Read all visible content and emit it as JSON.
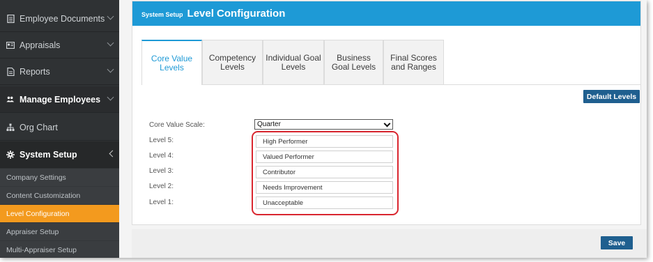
{
  "sidebar": {
    "items": [
      {
        "label": "Employee Documents",
        "icon": "document-icon"
      },
      {
        "label": "Appraisals",
        "icon": "id-card-icon"
      },
      {
        "label": "Reports",
        "icon": "report-icon"
      },
      {
        "label": "Manage Employees",
        "icon": "users-icon"
      },
      {
        "label": "Org Chart",
        "icon": "org-chart-icon"
      },
      {
        "label": "System Setup",
        "icon": "gear-icon"
      }
    ],
    "sub_items": [
      {
        "label": "Company Settings"
      },
      {
        "label": "Content Customization"
      },
      {
        "label": "Level Configuration"
      },
      {
        "label": "Appraiser Setup"
      },
      {
        "label": "Multi-Appraiser Setup"
      }
    ],
    "active_sub_item": "Level Configuration"
  },
  "header": {
    "section": "System Setup",
    "title": "Level Configuration"
  },
  "tabs": [
    {
      "label": "Core Value Levels",
      "active": true
    },
    {
      "label": "Competency Levels",
      "active": false
    },
    {
      "label": "Individual Goal Levels",
      "active": false
    },
    {
      "label": "Business Goal Levels",
      "active": false
    },
    {
      "label": "Final Scores and Ranges",
      "active": false
    }
  ],
  "buttons": {
    "default_levels": "Default Levels",
    "save": "Save"
  },
  "form": {
    "scale_label": "Core Value Scale:",
    "scale_value": "Quarter",
    "levels": [
      {
        "label": "Level 5:",
        "value": "High Performer"
      },
      {
        "label": "Level 4:",
        "value": "Valued Performer"
      },
      {
        "label": "Level 3:",
        "value": "Contributor"
      },
      {
        "label": "Level 2:",
        "value": "Needs Improvement"
      },
      {
        "label": "Level 1:",
        "value": "Unacceptable"
      }
    ]
  },
  "colors": {
    "header_blue": "#1e9ad6",
    "active_orange": "#f39a1e",
    "button_blue": "#1f5f8f",
    "highlight_red": "#d9262f",
    "sidebar_dark": "#2f3234"
  }
}
